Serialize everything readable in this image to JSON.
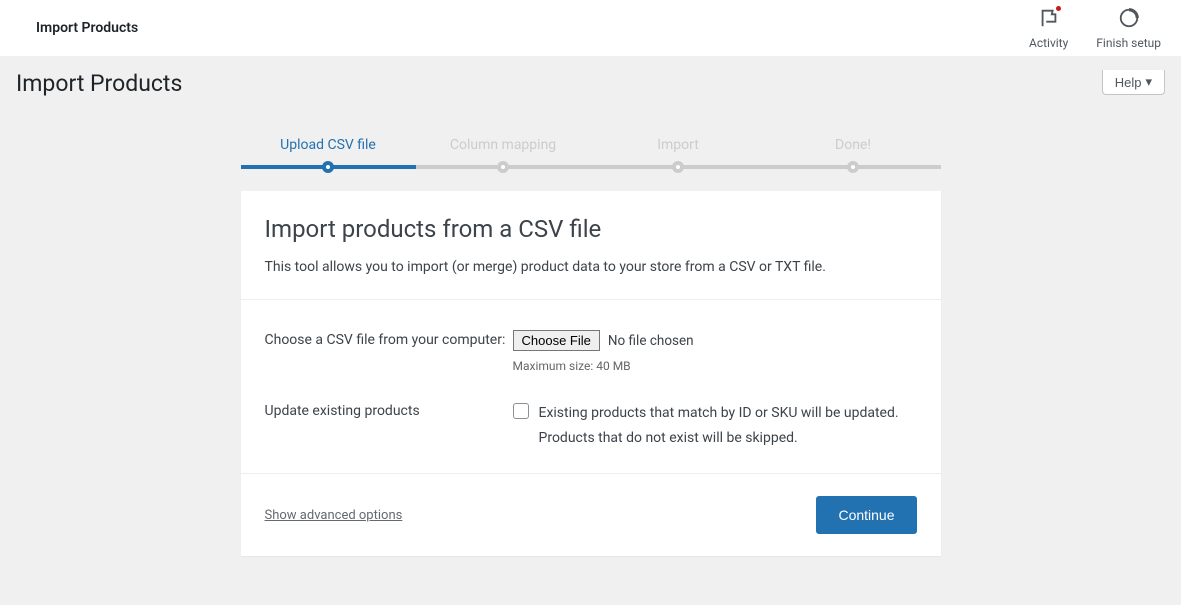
{
  "topbar": {
    "title": "Import Products",
    "activity_label": "Activity",
    "finish_setup_label": "Finish setup"
  },
  "page": {
    "title": "Import Products",
    "help_label": "Help"
  },
  "steps": [
    {
      "label": "Upload CSV file",
      "active": true
    },
    {
      "label": "Column mapping",
      "active": false
    },
    {
      "label": "Import",
      "active": false
    },
    {
      "label": "Done!",
      "active": false
    }
  ],
  "card": {
    "title": "Import products from a CSV file",
    "description": "This tool allows you to import (or merge) product data to your store from a CSV or TXT file."
  },
  "form": {
    "file_label": "Choose a CSV file from your computer:",
    "choose_file_button": "Choose File",
    "file_status": "No file chosen",
    "max_size_hint": "Maximum size: 40 MB",
    "update_label": "Update existing products",
    "update_desc": "Existing products that match by ID or SKU will be updated. Products that do not exist will be skipped."
  },
  "footer": {
    "advanced_link": "Show advanced options",
    "continue_button": "Continue"
  }
}
